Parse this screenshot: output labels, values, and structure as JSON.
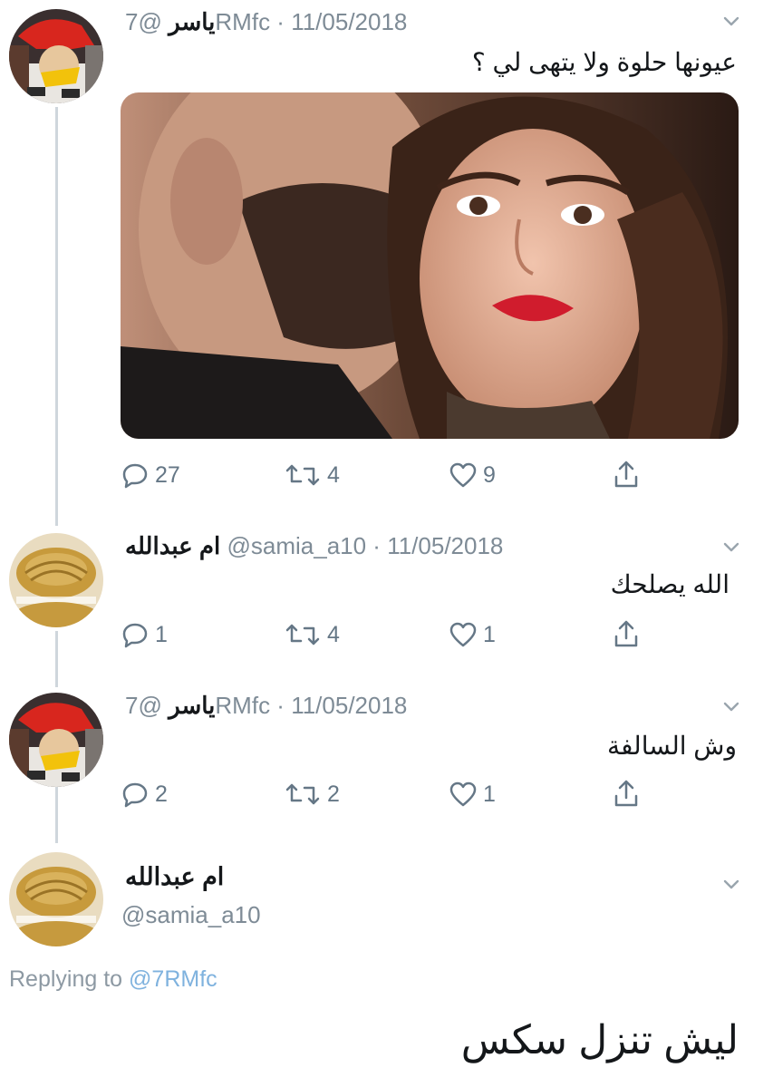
{
  "colors": {
    "text": "#14171a",
    "secondary": "#657786",
    "handle": "#7e8b96",
    "link": "#7fb2de",
    "thread_line": "#cfd6dc",
    "background": "#ffffff"
  },
  "tweets": [
    {
      "name": "ياسر",
      "handle": "@7RMfc",
      "date": "11/05/2018",
      "text": "عيونها حلوة ولا يتهى لي ؟",
      "has_image": true,
      "image_alt": "photo",
      "actions": {
        "replies": "27",
        "retweets": "4",
        "likes": "9"
      }
    },
    {
      "name": "ام عبدالله",
      "handle": "@samia_a10",
      "date": "11/05/2018",
      "text": "الله يصلحك",
      "actions": {
        "replies": "1",
        "retweets": "4",
        "likes": "1"
      }
    },
    {
      "name": "ياسر",
      "handle": "@7RMfc",
      "date": "11/05/2018",
      "text": "وش السالفة",
      "actions": {
        "replies": "2",
        "retweets": "2",
        "likes": "1"
      }
    }
  ],
  "main_tweet": {
    "name": "ام عبدالله",
    "handle": "@samia_a10",
    "replying_label": "Replying to",
    "replying_handle": "@7RMfc",
    "text": "ليش تنزل سكس"
  },
  "icons": {
    "reply": "reply-icon",
    "retweet": "retweet-icon",
    "like": "heart-icon",
    "share": "share-icon",
    "menu": "chevron-down-icon"
  }
}
